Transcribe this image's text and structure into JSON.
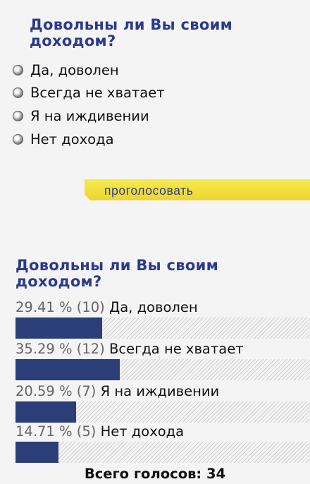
{
  "vote_form": {
    "title": "Довольны ли Вы своим доходом?",
    "options": [
      {
        "label": "Да, доволен"
      },
      {
        "label": "Всегда не хватает"
      },
      {
        "label": "Я на иждивении"
      },
      {
        "label": "Нет дохода"
      }
    ],
    "submit_label": "проголосовать"
  },
  "results": {
    "title": "Довольны ли Вы своим доходом?",
    "items": [
      {
        "percent_text": "29.41 % (10)",
        "label": "Да, доволен",
        "percent": 29.41
      },
      {
        "percent_text": "35.29 % (12)",
        "label": "Всегда не хватает",
        "percent": 35.29
      },
      {
        "percent_text": "20.59 % (7)",
        "label": "Я на иждивении",
        "percent": 20.59
      },
      {
        "percent_text": "14.71 % (5)",
        "label": "Нет дохода",
        "percent": 14.71
      }
    ],
    "total_text": "Всего голосов: 34"
  },
  "colors": {
    "title": "#2b3a8c",
    "bar": "#2c3e78",
    "button": "#f2e040"
  }
}
